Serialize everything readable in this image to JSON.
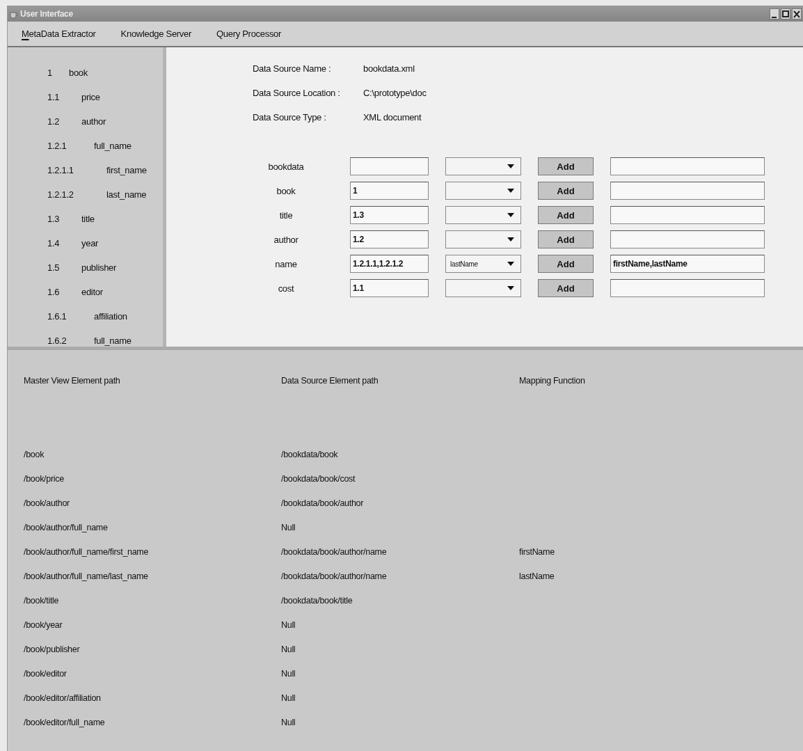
{
  "window": {
    "title": "User Interface"
  },
  "menu": [
    {
      "label": "MetaData Extractor",
      "selected": true
    },
    {
      "label": "Knowledge Server",
      "selected": false
    },
    {
      "label": "Query Processor",
      "selected": false
    }
  ],
  "tree": [
    {
      "number": "1",
      "label": "book",
      "children": [
        {
          "number": "1.1",
          "label": "price"
        },
        {
          "number": "1.2",
          "label": "author",
          "children": [
            {
              "number": "1.2.1",
              "label": "full_name",
              "children": [
                {
                  "number": "1.2.1.1",
                  "label": "first_name"
                },
                {
                  "number": "1.2.1.2",
                  "label": "last_name"
                }
              ]
            }
          ]
        },
        {
          "number": "1.3",
          "label": "title"
        },
        {
          "number": "1.4",
          "label": "year"
        },
        {
          "number": "1.5",
          "label": "publisher"
        },
        {
          "number": "1.6",
          "label": "editor",
          "children": [
            {
              "number": "1.6.1",
              "label": "affiliation"
            },
            {
              "number": "1.6.2",
              "label": "full_name"
            }
          ]
        }
      ]
    }
  ],
  "data_source": [
    {
      "label": "Data Source Name :",
      "value": "bookdata.xml"
    },
    {
      "label": "Data Source Location :",
      "value": "C:\\prototype\\doc"
    },
    {
      "label": "Data Source Type :",
      "value": "XML document"
    }
  ],
  "mapping_rows": [
    {
      "element": "bookdata",
      "button": "Add"
    },
    {
      "element": "book",
      "index": "1",
      "button": "Add"
    },
    {
      "element": "title",
      "index": "1.3",
      "button": "Add"
    },
    {
      "element": "author",
      "index": "1.2",
      "button": "Add"
    },
    {
      "element": "name",
      "index": "1.2.1.1,1.2.1.2",
      "function": "lastName",
      "button": "Add",
      "result": "firstName,lastName"
    },
    {
      "element": "cost",
      "index": "1.1",
      "button": "Add"
    }
  ],
  "table": {
    "columns": [
      "Master View Element path",
      "Data Source Element path",
      "Mapping Function"
    ],
    "rows": [
      {
        "master": "/book",
        "source": "/bookdata/book"
      },
      {
        "master": "/book/price",
        "source": "/bookdata/book/cost"
      },
      {
        "master": "/book/author",
        "source": "/bookdata/book/author"
      },
      {
        "master": "/book/author/full_name",
        "source": "Null"
      },
      {
        "master": "/book/author/full_name/first_name",
        "source": "/bookdata/book/author/name",
        "function": "firstName"
      },
      {
        "master": "/book/author/full_name/last_name",
        "source": "/bookdata/book/author/name",
        "function": "lastName"
      },
      {
        "master": "/book/title",
        "source": "/bookdata/book/title"
      },
      {
        "master": "/book/year",
        "source": "Null"
      },
      {
        "master": "/book/publisher",
        "source": "Null"
      },
      {
        "master": "/book/editor",
        "source": "Null"
      },
      {
        "master": "/book/editor/affiliation",
        "source": "Null"
      },
      {
        "master": "/book/editor/full_name",
        "source": "Null"
      }
    ]
  }
}
